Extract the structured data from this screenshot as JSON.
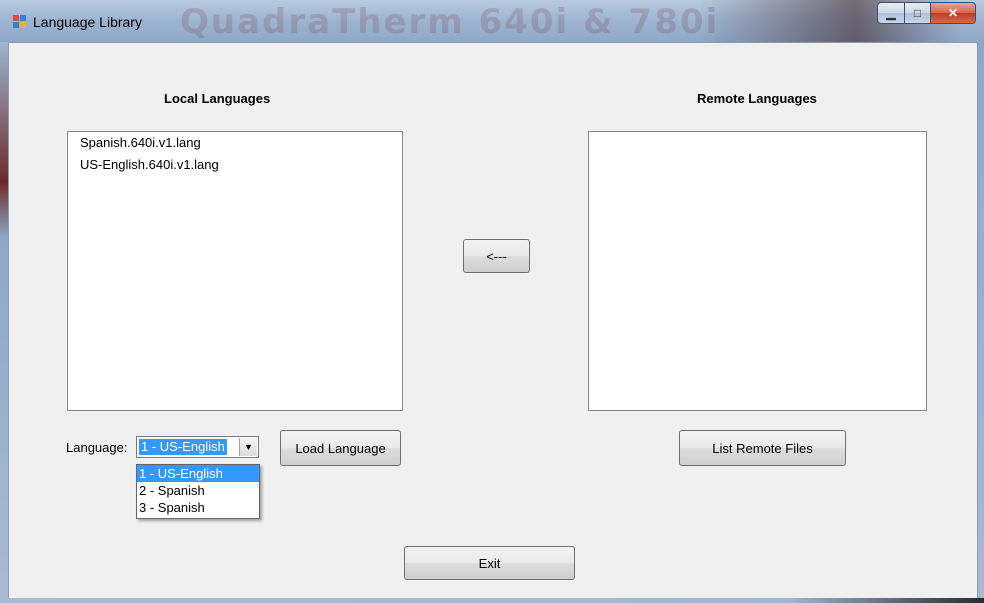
{
  "window": {
    "title": "Language Library",
    "background_title_text": "QuadraTherm 640i & 780i"
  },
  "local": {
    "heading": "Local Languages",
    "files": [
      "Spanish.640i.v1.lang",
      "US-English.640i.v1.lang"
    ]
  },
  "remote": {
    "heading": "Remote Languages",
    "files": []
  },
  "transfer_button": {
    "label": "<---"
  },
  "language_selector": {
    "label": "Language:",
    "selected": "1 - US-English",
    "options": [
      "1 - US-English",
      "2 - Spanish",
      "3 - Spanish"
    ]
  },
  "load_button": {
    "label": "Load Language"
  },
  "list_remote_button": {
    "label": "List Remote Files"
  },
  "exit_button": {
    "label": "Exit"
  },
  "colors": {
    "selection": "#3399ff",
    "client_background": "#f0f0f0",
    "close_button": "#c23a1c"
  }
}
